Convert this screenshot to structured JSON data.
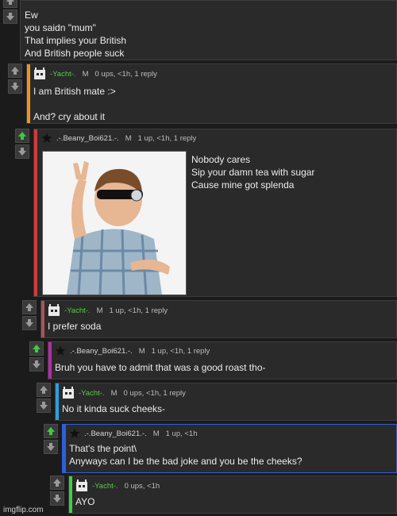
{
  "watermark": "imgflip.com",
  "comments": [
    {
      "text": "Ew\nyou saidn \"mum\"\nThat implies your British\nAnd British people suck"
    },
    {
      "user": "-Yacht-.",
      "mod": "M",
      "stats": "0 ups, <1h, 1 reply",
      "text": "I am British mate :>\n\nAnd? cry about it",
      "stripe": "#f0931d",
      "avatar": "robot"
    },
    {
      "user": ".-.Beany_Boi621.-.",
      "mod": "M",
      "stats": "1 up, <1h, 1 reply",
      "text": "Nobody cares\nSip your damn tea with sugar\nCause mine got splenda",
      "stripe": "#d23a3a",
      "avatar": "star",
      "image_alt": "kid in sunglasses posing"
    },
    {
      "user": "-Yacht-.",
      "mod": "M",
      "stats": "1 up, <1h, 1 reply",
      "text": "I prefer soda",
      "stripe": "#a6555b",
      "avatar": "robot"
    },
    {
      "user": ".-.Beany_Boi621.-.",
      "mod": "M",
      "stats": "1 up, <1h, 1 reply",
      "text": "Bruh you have to admit that was a good roast tho-",
      "stripe": "#b12ea8",
      "avatar": "star"
    },
    {
      "user": "-Yacht-.",
      "mod": "M",
      "stats": "0 ups, <1h, 1 reply",
      "text": "No it kinda suck cheeks-",
      "stripe": "#2b9fde",
      "avatar": "robot"
    },
    {
      "user": ".-.Beany_Boi621.-.",
      "mod": "M",
      "stats": "1 up, <1h",
      "text": "That's the point\\\nAnyways can I be the bad joke and you be the cheeks?",
      "stripe": "#2f5fd8",
      "avatar": "star"
    },
    {
      "user": "-Yacht-.",
      "stats": "0 ups, <1h",
      "text": "AYO",
      "stripe": "#3ed142",
      "avatar": "robot"
    }
  ]
}
